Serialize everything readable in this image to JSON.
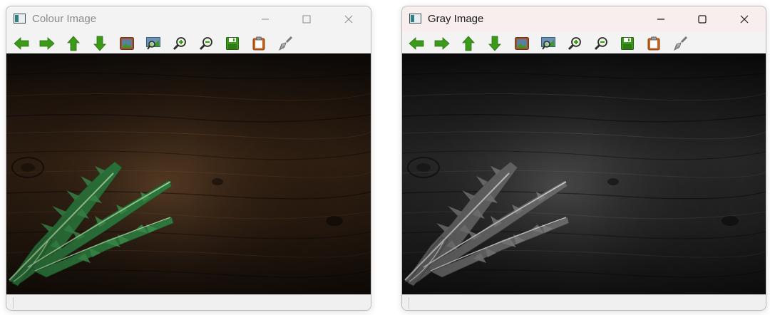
{
  "windows": {
    "colour": {
      "title": "Colour Image"
    },
    "gray": {
      "title": "Gray Image"
    }
  },
  "controls": {
    "minimize_icon": "minimize-icon",
    "maximize_icon": "maximize-icon",
    "close_icon": "close-icon"
  },
  "toolbar": {
    "buttons": [
      {
        "name": "pan-left",
        "icon": "arrow-left-icon"
      },
      {
        "name": "pan-right",
        "icon": "arrow-right-icon"
      },
      {
        "name": "pan-up",
        "icon": "arrow-up-icon"
      },
      {
        "name": "pan-down",
        "icon": "arrow-down-icon"
      },
      {
        "name": "zoom-original",
        "icon": "picture-icon"
      },
      {
        "name": "zoom-fit",
        "icon": "zoom-picture-icon"
      },
      {
        "name": "zoom-in",
        "icon": "zoom-in-icon"
      },
      {
        "name": "zoom-out",
        "icon": "zoom-out-icon"
      },
      {
        "name": "save",
        "icon": "save-icon"
      },
      {
        "name": "copy",
        "icon": "clipboard-icon"
      },
      {
        "name": "properties",
        "icon": "brush-icon"
      }
    ]
  },
  "images": {
    "colour": {
      "content": "fern leaf on dark wood",
      "mode": "colour"
    },
    "gray": {
      "content": "fern leaf on dark wood",
      "mode": "grayscale"
    }
  },
  "colors": {
    "wood_dark": "#1a1109",
    "wood_mid": "#3b2718",
    "fern_green": "#2e7a3e",
    "toolbar_green": "#3c9a1a"
  }
}
